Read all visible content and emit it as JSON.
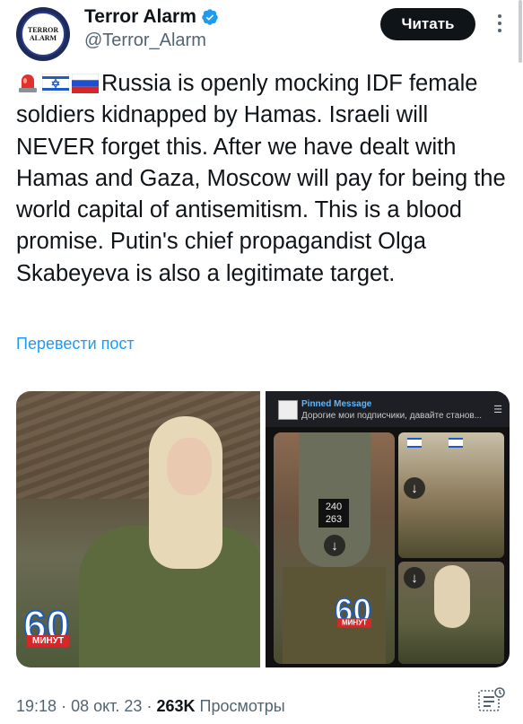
{
  "header": {
    "display_name": "Terror Alarm",
    "handle": "@Terror_Alarm",
    "avatar_text": "TERROR ALARM",
    "follow_label": "Читать"
  },
  "tweet": {
    "text": "Russia is openly mocking IDF female soldiers kidnapped by Hamas. Israeli will NEVER forget this. After we have dealt with Hamas and Gaza, Moscow will pay for being the world capital of antisemitism. This is a blood promise. Putin's chief propagandist Olga Skabeyeva is also a legitimate target.",
    "emojis": [
      "rotating-light-icon",
      "israel-flag-icon",
      "russia-flag-icon"
    ],
    "translate_label": "Перевести пост"
  },
  "media": {
    "badge_number": "60",
    "badge_label": "МИНУТ",
    "pinned_title": "Pinned Message",
    "pinned_text": "Дорогие мои подписчики, давайте станов...",
    "tag_text": "240 263"
  },
  "meta": {
    "time": "19:18",
    "date": "08 окт. 23",
    "views_count": "263K",
    "views_label": "Просмотры"
  },
  "colors": {
    "link": "#1d9bf0",
    "secondary_text": "#536471",
    "primary_text": "#0f1419",
    "verified": "#1d9bf0"
  }
}
